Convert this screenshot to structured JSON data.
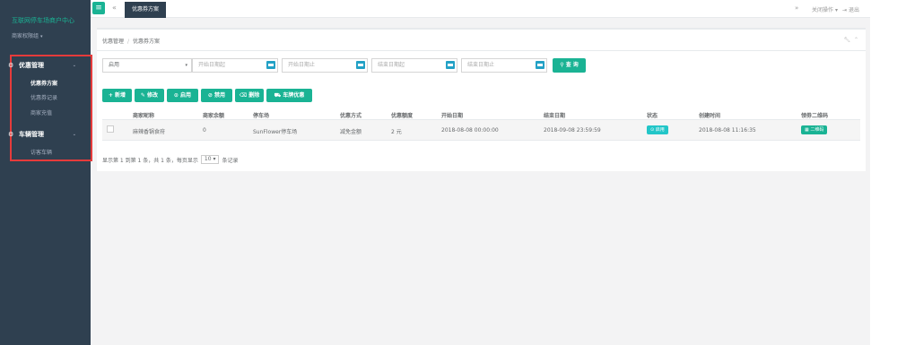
{
  "sidebar": {
    "brand": "互联网停车场商户中心",
    "user_role": "商家权限组",
    "groups": [
      {
        "label": "优惠管理",
        "items": [
          "优惠券方案",
          "优惠券记录",
          "商家充值"
        ]
      },
      {
        "label": "车辆管理",
        "items": [
          "访客车辆"
        ]
      }
    ]
  },
  "topbar": {
    "active_tab": "优惠券方案",
    "close_ops": "关闭操作",
    "logout": "退出"
  },
  "breadcrumb": {
    "parent": "优惠管理",
    "current": "优惠券方案"
  },
  "filters": {
    "status_value": "启用",
    "start_from_placeholder": "开始日期起",
    "start_to_placeholder": "开始日期止",
    "end_from_placeholder": "结束日期起",
    "end_to_placeholder": "结束日期止",
    "query_label": "查 询"
  },
  "toolbar": {
    "add": "新增",
    "edit": "修改",
    "enable": "启用",
    "disable": "禁用",
    "delete": "删除",
    "plate": "车牌优惠"
  },
  "table": {
    "columns": [
      "商家昵称",
      "商家余额",
      "停车场",
      "优惠方式",
      "优惠额度",
      "开始日期",
      "结束日期",
      "状态",
      "创建时间",
      "领劵二维码"
    ],
    "rows": [
      {
        "merchant": "麻辣香锅食府",
        "balance": "0",
        "parking": "SunFlower停车场",
        "mode": "减免金额",
        "amount": "2 元",
        "start": "2018-08-08 00:00:00",
        "end": "2018-09-08 23:59:59",
        "status": "启用",
        "created": "2018-08-08 11:16:35",
        "qr": "二维码"
      }
    ]
  },
  "pager": {
    "summary": "显示第 1 到第 1 条，共 1 条，每页显示",
    "page_size": "10",
    "suffix": "条记录"
  },
  "colors": {
    "primary": "#1ab394",
    "sidebar": "#2f4050",
    "info": "#23c6c8",
    "highlight_box": "#e63b3b"
  }
}
